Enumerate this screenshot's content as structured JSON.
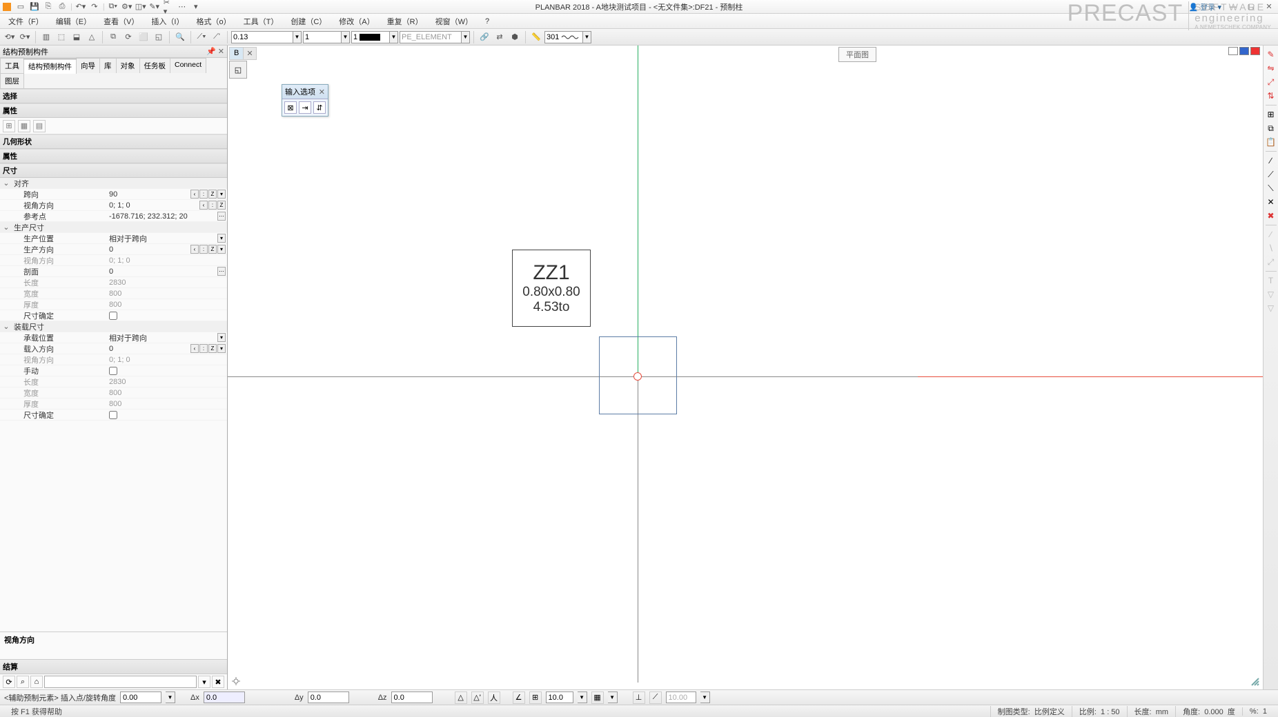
{
  "title": "PLANBAR 2018 - A地块测试项目 - <无文件集>:DF21 - 预制柱",
  "login": "登录",
  "menus": [
    "文件（F）",
    "编辑（E）",
    "查看（V）",
    "插入（I）",
    "格式（o）",
    "工具（T）",
    "创建（C）",
    "修改（A）",
    "重复（R）",
    "视窗（W）",
    "?"
  ],
  "toolbar": {
    "line_val": "0.13",
    "ltype_val": "1",
    "color_box": "1",
    "layer": "PE_ELEMENT",
    "ruler": "301"
  },
  "brand": {
    "main": "PRECAST",
    "sw": "SOFTWARE",
    "eng": "engineering",
    "sub": "A NEMETSCHEK COMPANY"
  },
  "panel": {
    "title": "结构预制构件",
    "tabs": [
      "工具",
      "结构预制构件",
      "向导",
      "库",
      "对象",
      "任务板",
      "Connect",
      "图层"
    ],
    "active_tab": 1,
    "s_select": "选择",
    "s_attr": "属性",
    "s_geo": "几何形状",
    "s_attr2": "属性",
    "s_size": "尺寸",
    "groups": {
      "align": {
        "label": "对齐",
        "rows": [
          {
            "k": "跨向",
            "v": "90",
            "btns": true
          },
          {
            "k": "视角方向",
            "v": "0; 1; 0",
            "btns": true,
            "dim": false
          },
          {
            "k": "参考点",
            "v": "-1678.716; 232.312; 20",
            "dots": true
          }
        ]
      },
      "prod": {
        "label": "生产尺寸",
        "rows": [
          {
            "k": "生产位置",
            "v": "相对于跨向",
            "combo": true
          },
          {
            "k": "生产方向",
            "v": "0",
            "btns": true
          },
          {
            "k": "视角方向",
            "v": "0; 1; 0",
            "dim": true
          },
          {
            "k": "剖面",
            "v": "0",
            "dots": true
          },
          {
            "k": "长度",
            "v": "2830",
            "dim": true
          },
          {
            "k": "宽度",
            "v": "800",
            "dim": true
          },
          {
            "k": "厚度",
            "v": "800",
            "dim": true
          },
          {
            "k": "尺寸确定",
            "check": true
          }
        ]
      },
      "inst": {
        "label": "装载尺寸",
        "rows": [
          {
            "k": "承载位置",
            "v": "相对于跨向",
            "combo": true
          },
          {
            "k": "载入方向",
            "v": "0",
            "btns": true
          },
          {
            "k": "视角方向",
            "v": "0; 1; 0",
            "dim": true
          },
          {
            "k": "手动",
            "check": true
          },
          {
            "k": "长度",
            "v": "2830",
            "dim": true
          },
          {
            "k": "宽度",
            "v": "800",
            "dim": true
          },
          {
            "k": "厚度",
            "v": "800",
            "dim": true
          },
          {
            "k": "尺寸确定",
            "check": true
          }
        ]
      }
    },
    "desc": "视角方向",
    "result": "结算"
  },
  "canvas": {
    "tab": "B",
    "view_name": "平面图",
    "float_title": "输入选项",
    "label": {
      "l1": "ZZ1",
      "l2": "0.80x0.80",
      "l3": "4.53to"
    }
  },
  "coord": {
    "prompt": "<辅助预制元素> 插入点/旋转角度",
    "v1": "0.00",
    "dx_lbl": "Δx",
    "dx": "0.0",
    "dy_lbl": "Δy",
    "dy": "0.0",
    "dz_lbl": "Δz",
    "dz": "0.0",
    "ang": "10.0",
    "off": "10.00"
  },
  "status": {
    "help": "按 F1 获得帮助",
    "drawtype_lbl": "制图类型:",
    "drawtype": "比例定义",
    "scale_lbl": "比例:",
    "scale": "1 : 50",
    "len_lbl": "长度:",
    "len": "mm",
    "ang_lbl": "角度:",
    "ang": "0.000",
    "deg": "度",
    "pct_lbl": "%:",
    "pct": "1"
  }
}
